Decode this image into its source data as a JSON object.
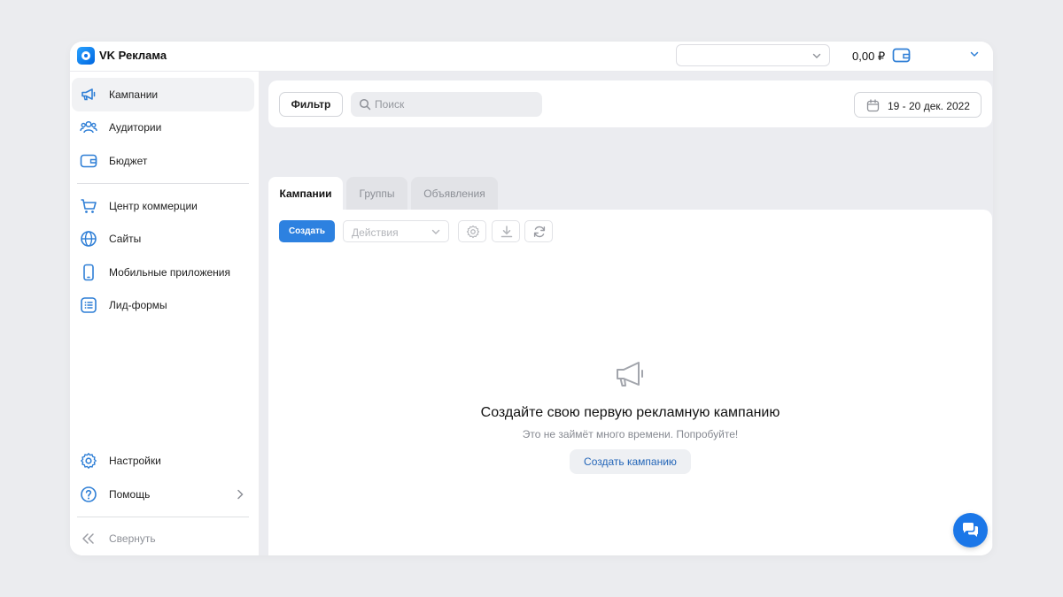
{
  "app": {
    "brand": "VK Реклама"
  },
  "topbar": {
    "account_select_value": "",
    "balance": "0,00 ₽"
  },
  "sidebar": {
    "items": [
      {
        "label": "Кампании",
        "icon": "megaphone-icon"
      },
      {
        "label": "Аудитории",
        "icon": "users-icon"
      },
      {
        "label": "Бюджет",
        "icon": "wallet-icon"
      },
      {
        "label": "Центр коммерции",
        "icon": "cart-icon"
      },
      {
        "label": "Сайты",
        "icon": "globe-icon"
      },
      {
        "label": "Мобильные приложения",
        "icon": "smartphone-icon"
      },
      {
        "label": "Лид-формы",
        "icon": "form-list-icon"
      }
    ],
    "bottom": [
      {
        "label": "Настройки",
        "icon": "gear-icon"
      },
      {
        "label": "Помощь",
        "icon": "help-icon"
      }
    ],
    "collapse_label": "Свернуть"
  },
  "toolbar": {
    "filter_label": "Фильтр",
    "search_placeholder": "Поиск",
    "date_range": "19 - 20 дек. 2022"
  },
  "tabs": [
    {
      "label": "Кампании",
      "active": true
    },
    {
      "label": "Группы",
      "active": false
    },
    {
      "label": "Объявления",
      "active": false
    }
  ],
  "table_toolbar": {
    "create_label": "Создать",
    "actions_placeholder": "Действия"
  },
  "empty_state": {
    "title": "Создайте свою первую рекламную кампанию",
    "subtitle": "Это не займёт много времени. Попробуйте!",
    "button_label": "Создать кампанию"
  },
  "colors": {
    "accent": "#2d81e0",
    "icon_blue": "#2f7fd6",
    "page_bg": "#ebecef",
    "chat_fab": "#1b77e8"
  }
}
